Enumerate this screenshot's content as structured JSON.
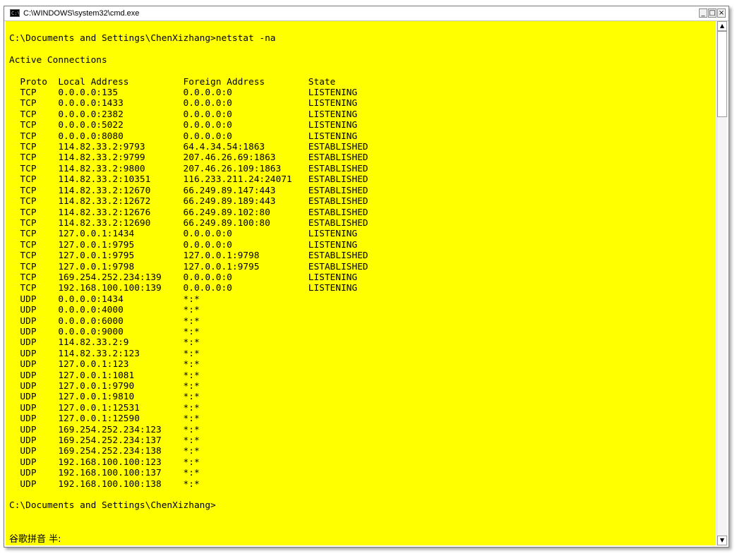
{
  "window": {
    "title": "C:\\WINDOWS\\system32\\cmd.exe",
    "icon_label": "C:\\",
    "minimize_glyph": "_",
    "maximize_glyph": "□",
    "close_glyph": "×"
  },
  "console": {
    "lines": [
      "C:\\Documents and Settings\\ChenXizhang>netstat -na",
      "",
      "Active Connections",
      "",
      "  Proto  Local Address          Foreign Address        State",
      "  TCP    0.0.0.0:135            0.0.0.0:0              LISTENING",
      "  TCP    0.0.0.0:1433           0.0.0.0:0              LISTENING",
      "  TCP    0.0.0.0:2382           0.0.0.0:0              LISTENING",
      "  TCP    0.0.0.0:5022           0.0.0.0:0              LISTENING",
      "  TCP    0.0.0.0:8080           0.0.0.0:0              LISTENING",
      "  TCP    114.82.33.2:9793       64.4.34.54:1863        ESTABLISHED",
      "  TCP    114.82.33.2:9799       207.46.26.69:1863      ESTABLISHED",
      "  TCP    114.82.33.2:9800       207.46.26.109:1863     ESTABLISHED",
      "  TCP    114.82.33.2:10351      116.233.211.24:24071   ESTABLISHED",
      "  TCP    114.82.33.2:12670      66.249.89.147:443      ESTABLISHED",
      "  TCP    114.82.33.2:12672      66.249.89.189:443      ESTABLISHED",
      "  TCP    114.82.33.2:12676      66.249.89.102:80       ESTABLISHED",
      "  TCP    114.82.33.2:12690      66.249.89.100:80       ESTABLISHED",
      "  TCP    127.0.0.1:1434         0.0.0.0:0              LISTENING",
      "  TCP    127.0.0.1:9795         0.0.0.0:0              LISTENING",
      "  TCP    127.0.0.1:9795         127.0.0.1:9798         ESTABLISHED",
      "  TCP    127.0.0.1:9798         127.0.0.1:9795         ESTABLISHED",
      "  TCP    169.254.252.234:139    0.0.0.0:0              LISTENING",
      "  TCP    192.168.100.100:139    0.0.0.0:0              LISTENING",
      "  UDP    0.0.0.0:1434           *:*",
      "  UDP    0.0.0.0:4000           *:*",
      "  UDP    0.0.0.0:6000           *:*",
      "  UDP    0.0.0.0:9000           *:*",
      "  UDP    114.82.33.2:9          *:*",
      "  UDP    114.82.33.2:123        *:*",
      "  UDP    127.0.0.1:123          *:*",
      "  UDP    127.0.0.1:1081         *:*",
      "  UDP    127.0.0.1:9790         *:*",
      "  UDP    127.0.0.1:9810         *:*",
      "  UDP    127.0.0.1:12531        *:*",
      "  UDP    127.0.0.1:12590        *:*",
      "  UDP    169.254.252.234:123    *:*",
      "  UDP    169.254.252.234:137    *:*",
      "  UDP    169.254.252.234:138    *:*",
      "  UDP    192.168.100.100:123    *:*",
      "  UDP    192.168.100.100:137    *:*",
      "  UDP    192.168.100.100:138    *:*",
      "",
      "C:\\Documents and Settings\\ChenXizhang>"
    ],
    "ime_status": "谷歌拼音 半:"
  },
  "scrollbar": {
    "up_glyph": "▲",
    "down_glyph": "▼"
  },
  "colors": {
    "console_background": "#ffff00",
    "console_text": "#000000"
  }
}
